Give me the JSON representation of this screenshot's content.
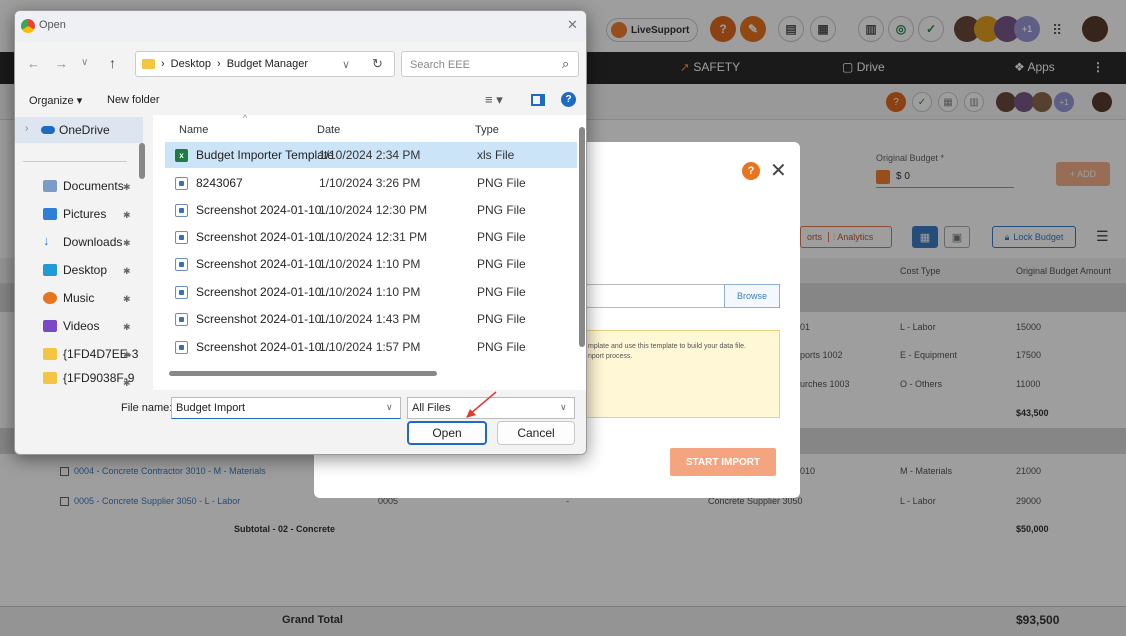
{
  "topbar": {
    "live_support": "LiveSupport",
    "badge": "+1"
  },
  "navbar": {
    "safety": "SAFETY",
    "drive": "Drive",
    "apps": "Apps"
  },
  "budget": {
    "toolbar": {
      "reports_tab": "orts",
      "analytics_tab": "Analytics",
      "lock_budget": "Lock Budget"
    },
    "headers": {
      "cost_type": "Cost Type",
      "original_budget_amount": "Original Budget Amount"
    },
    "rows_group1": [
      {
        "code_tail": "01",
        "cost_type": "L - Labor",
        "amount": "15000"
      },
      {
        "code_tail": "ports 1002",
        "cost_type": "E - Equipment",
        "amount": "17500"
      },
      {
        "code_tail": "urches 1003",
        "cost_type": "O - Others",
        "amount": "11000"
      }
    ],
    "subtotal_group1": "$43,500",
    "rows_group2": [
      {
        "name": "0004 - Concrete Contractor 3010 - M - Materials",
        "code": "",
        "desc": "010",
        "cost_type": "M - Materials",
        "amount": "21000"
      },
      {
        "name": "0005 - Concrete Supplier 3050 - L - Labor",
        "code": "0005",
        "dash": "-",
        "desc": "Concrete Supplier 3050",
        "cost_type": "L - Labor",
        "amount": "29000"
      }
    ],
    "subtotal_group2_label": "Subtotal - 02 - Concrete",
    "subtotal_group2": "$50,000",
    "grand_total_label": "Grand Total",
    "grand_total": "$93,500"
  },
  "add_form": {
    "original_budget_label": "Original Budget *",
    "original_budget_value": "$ 0",
    "add_button": "+ ADD"
  },
  "import_modal": {
    "browse": "Browse",
    "info_line1": "mplate and use this template to build your data file.",
    "info_line2": "nport process.",
    "start_import": "START IMPORT"
  },
  "file_dialog": {
    "title": "Open",
    "breadcrumb": [
      "Desktop",
      "Budget Manager"
    ],
    "search_placeholder": "Search EEE",
    "organize": "Organize ▾",
    "new_folder": "New folder",
    "nav": {
      "onedrive": "OneDrive",
      "items": [
        "Documents",
        "Pictures",
        "Downloads",
        "Desktop",
        "Music",
        "Videos",
        "{1FD4D7EE-3",
        "{1FD9038F-9"
      ]
    },
    "columns": {
      "name": "Name",
      "date": "Date",
      "type": "Type"
    },
    "files": [
      {
        "name": "Budget Importer Template",
        "date": "1/10/2024 2:34 PM",
        "type": "xls File",
        "kind": "xls"
      },
      {
        "name": "8243067",
        "date": "1/10/2024 3:26 PM",
        "type": "PNG File",
        "kind": "png"
      },
      {
        "name": "Screenshot 2024-01-10...",
        "date": "1/10/2024 12:30 PM",
        "type": "PNG File",
        "kind": "png"
      },
      {
        "name": "Screenshot 2024-01-10...",
        "date": "1/10/2024 12:31 PM",
        "type": "PNG File",
        "kind": "png"
      },
      {
        "name": "Screenshot 2024-01-10...",
        "date": "1/10/2024 1:10 PM",
        "type": "PNG File",
        "kind": "png"
      },
      {
        "name": "Screenshot 2024-01-10...",
        "date": "1/10/2024 1:10 PM",
        "type": "PNG File",
        "kind": "png"
      },
      {
        "name": "Screenshot 2024-01-10...",
        "date": "1/10/2024 1:43 PM",
        "type": "PNG File",
        "kind": "png"
      },
      {
        "name": "Screenshot 2024-01-10...",
        "date": "1/10/2024 1:57 PM",
        "type": "PNG File",
        "kind": "png"
      }
    ],
    "file_name_label": "File name:",
    "file_name_value": "Budget Import",
    "file_type": "All Files",
    "open_button": "Open",
    "cancel_button": "Cancel"
  },
  "colors": {
    "accent_orange": "#f0a070",
    "selection": "#cce4f7",
    "navbar": "#2b2b2b",
    "link_blue": "#3b7dc4"
  }
}
